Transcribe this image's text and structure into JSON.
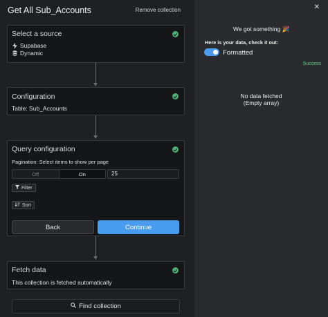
{
  "header": {
    "title": "Get All Sub_Accounts",
    "remove_label": "Remove collection"
  },
  "steps": {
    "source": {
      "title": "Select a source",
      "items": [
        {
          "icon": "supabase-icon",
          "label": "Supabase"
        },
        {
          "icon": "database-icon",
          "label": "Dynamic"
        }
      ]
    },
    "configuration": {
      "title": "Configuration",
      "table_text": "Table: Sub_Accounts"
    },
    "query": {
      "title": "Query configuration",
      "pagination_label": "Pagination: Select items to show per page",
      "toggle_off": "Off",
      "toggle_on": "On",
      "items_per_page": "25",
      "filter_label": "Filter",
      "sort_label": "Sort",
      "back_label": "Back",
      "continue_label": "Continue"
    },
    "fetch": {
      "title": "Fetch data",
      "description": "This collection is fetched automatically"
    }
  },
  "find_button_label": "Find collection",
  "result_panel": {
    "title": "We got something 🎉",
    "subtitle": "Here is your data, check it out:",
    "formatted_label": "Formatted",
    "formatted_on": true,
    "status": "Success",
    "empty_line1": "No data fetched",
    "empty_line2": "(Empty array)"
  },
  "colors": {
    "accent": "#4a9cf0",
    "success": "#5bd17f",
    "check": "#4fae73"
  }
}
